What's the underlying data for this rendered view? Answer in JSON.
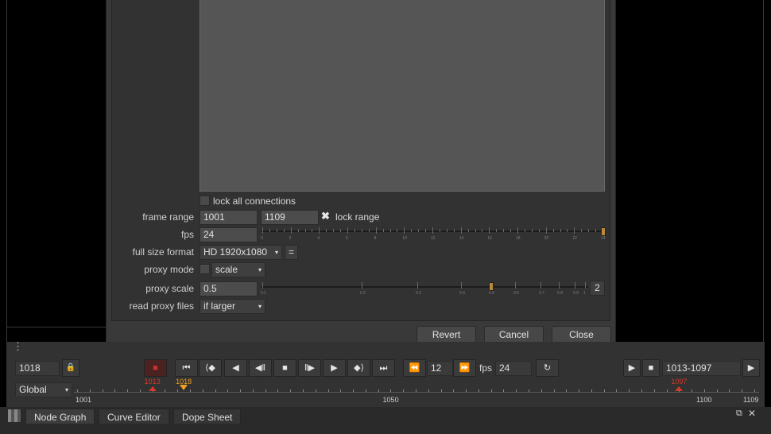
{
  "dialog": {
    "lock_all_connections": "lock all connections",
    "frame_range_label": "frame range",
    "frame_range_start": "1001",
    "frame_range_end": "1109",
    "lock_range_label": "lock range",
    "fps_label": "fps",
    "fps_value": "24",
    "fps_slider_ticks": [
      "0",
      "2",
      "4",
      "6",
      "8",
      "10",
      "12",
      "14",
      "16",
      "18",
      "20",
      "22",
      "24"
    ],
    "fps_slider_value": 24,
    "full_size_format_label": "full size format",
    "full_size_format_value": "HD 1920x1080",
    "equals_button": "=",
    "proxy_mode_label": "proxy mode",
    "proxy_mode_value": "scale",
    "proxy_scale_label": "proxy scale",
    "proxy_scale_value": "0.5",
    "proxy_scale_ticks": [
      "0.1",
      "0.2",
      "0.3",
      "0.4",
      "0.5",
      "0.6",
      "0.7",
      "0.8",
      "0.9",
      "1"
    ],
    "proxy_scale_slider_value": 0.5,
    "proxy_scale_step_button": "2",
    "read_proxy_files_label": "read proxy files",
    "read_proxy_files_value": "if larger",
    "revert": "Revert",
    "cancel": "Cancel",
    "close": "Close"
  },
  "timeline": {
    "current_frame_left": "1018",
    "playback_step": "12",
    "fps_label": "fps",
    "fps_value": "24",
    "range_value": "1013-1097",
    "scope": "Global",
    "in_point": "1013",
    "current_marker": "1018",
    "out_point": "1097",
    "ruler_labels": [
      "1001",
      "1050",
      "1100",
      "1109"
    ]
  },
  "tabs": [
    "Node Graph",
    "Curve Editor",
    "Dope Sheet"
  ],
  "colors": {
    "accent_orange": "#f0a020",
    "marker_red": "#d23a2a",
    "stop_red": "#b42a2a"
  }
}
